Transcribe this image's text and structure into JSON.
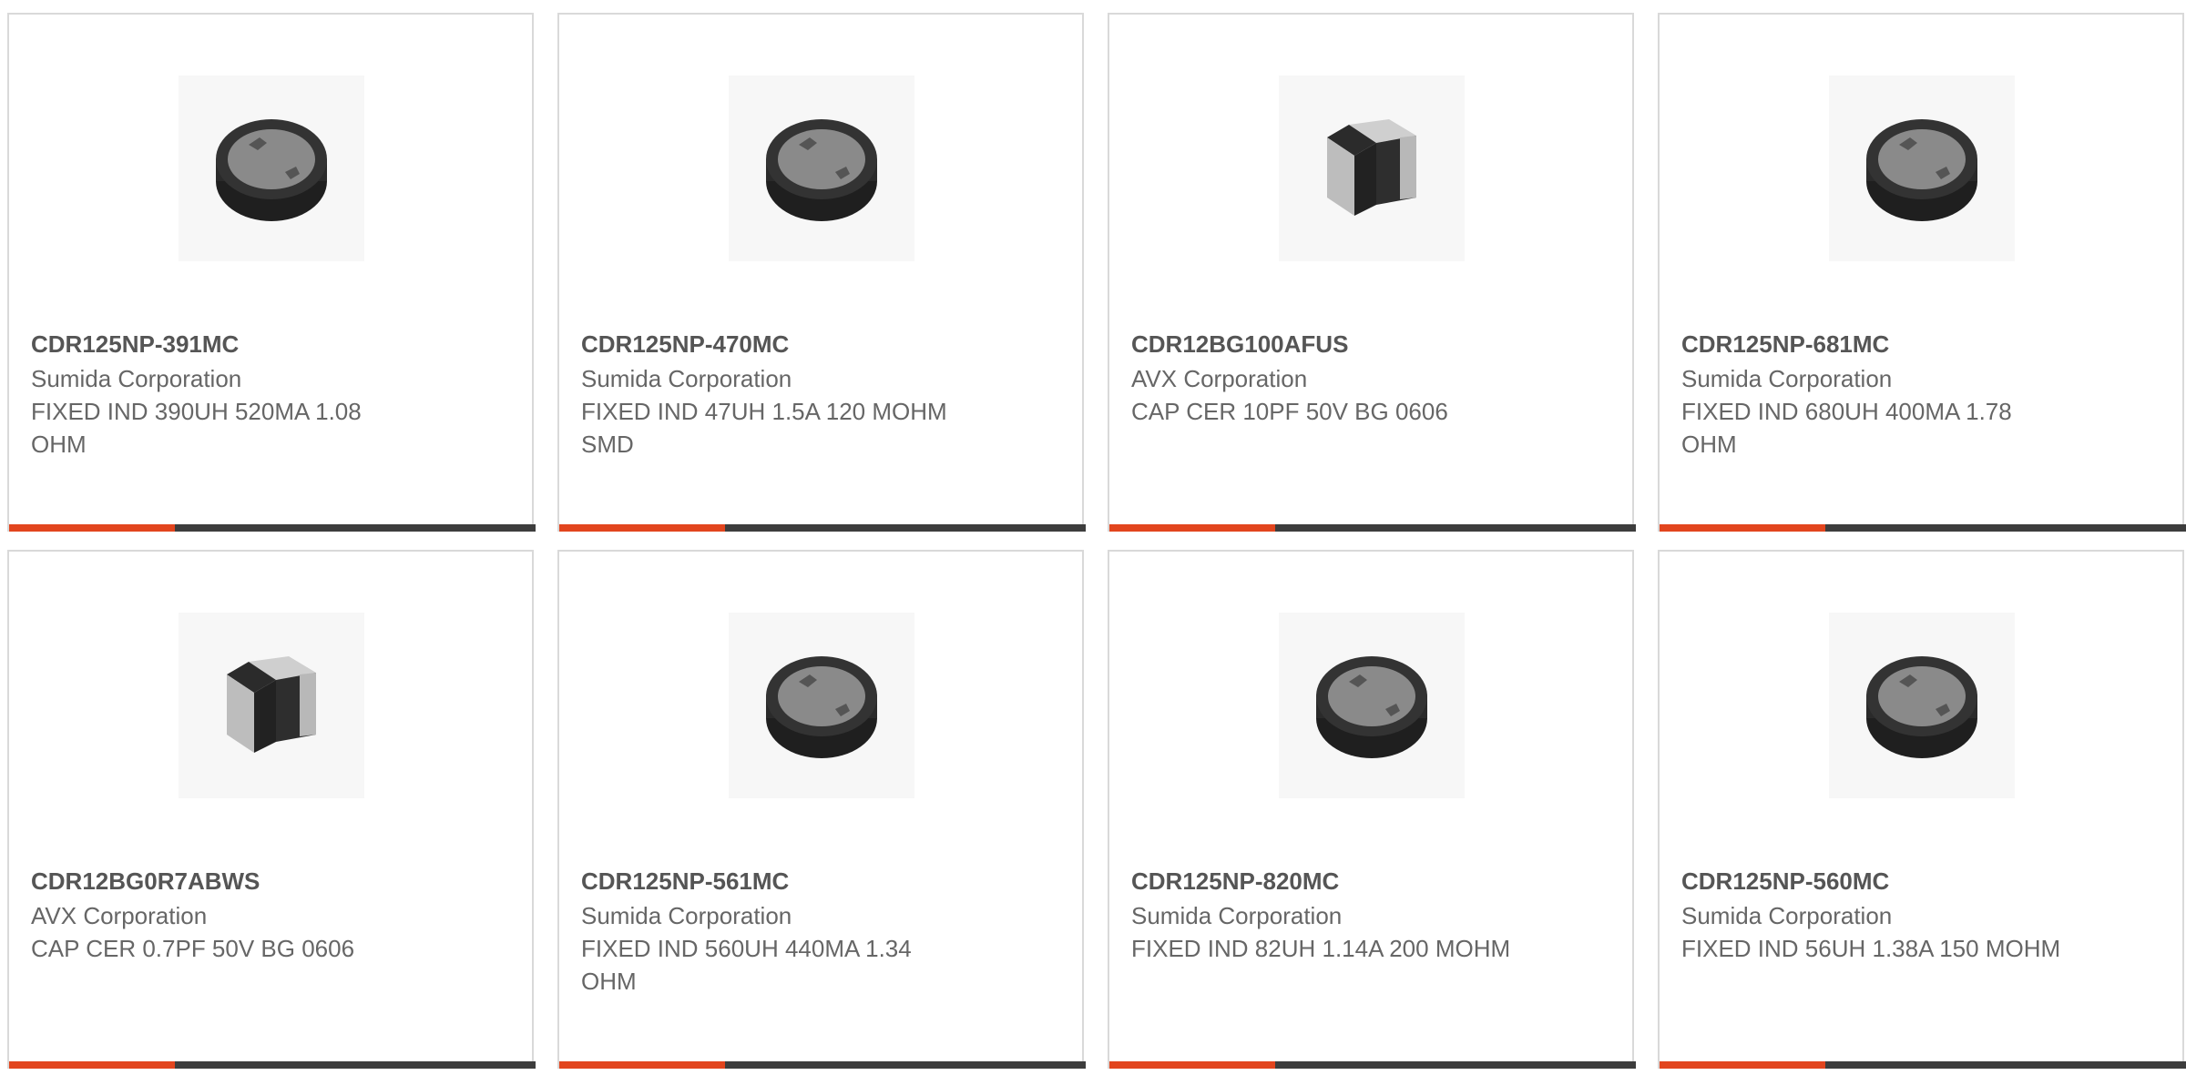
{
  "colors": {
    "accent": "#e2451e",
    "bar": "#3d3d3d",
    "border": "#d9d9d9",
    "title_text": "#555555",
    "body_text": "#666666"
  },
  "products": [
    {
      "part_number": "CDR125NP-391MC",
      "manufacturer": "Sumida Corporation",
      "description": "FIXED IND 390UH 520MA 1.08 OHM",
      "image": "inductor-icon"
    },
    {
      "part_number": "CDR125NP-470MC",
      "manufacturer": "Sumida Corporation",
      "description": "FIXED IND 47UH 1.5A 120 MOHM SMD",
      "image": "inductor-icon"
    },
    {
      "part_number": "CDR12BG100AFUS",
      "manufacturer": "AVX Corporation",
      "description": "CAP CER 10PF 50V BG 0606",
      "image": "capacitor-icon"
    },
    {
      "part_number": "CDR125NP-681MC",
      "manufacturer": "Sumida Corporation",
      "description": "FIXED IND 680UH 400MA 1.78 OHM",
      "image": "inductor-icon"
    },
    {
      "part_number": "CDR12BG0R7ABWS",
      "manufacturer": "AVX Corporation",
      "description": "CAP CER 0.7PF 50V BG 0606",
      "image": "capacitor-icon"
    },
    {
      "part_number": "CDR125NP-561MC",
      "manufacturer": "Sumida Corporation",
      "description": "FIXED IND 560UH 440MA 1.34 OHM",
      "image": "inductor-icon"
    },
    {
      "part_number": "CDR125NP-820MC",
      "manufacturer": "Sumida Corporation",
      "description": "FIXED IND 82UH 1.14A 200 MOHM",
      "image": "inductor-icon"
    },
    {
      "part_number": "CDR125NP-560MC",
      "manufacturer": "Sumida Corporation",
      "description": "FIXED IND 56UH 1.38A 150 MOHM",
      "image": "inductor-icon"
    }
  ]
}
